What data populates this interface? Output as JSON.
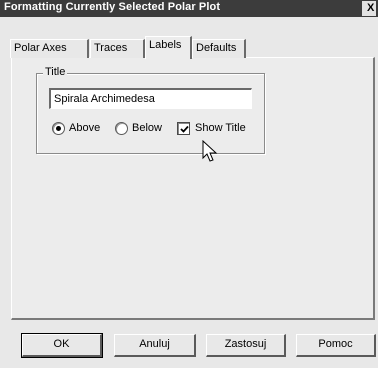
{
  "window": {
    "title": "Formatting Currently Selected Polar Plot",
    "close_label": "X"
  },
  "tabs": [
    {
      "label": "Polar Axes",
      "active": false
    },
    {
      "label": "Traces",
      "active": false
    },
    {
      "label": "Labels",
      "active": true
    },
    {
      "label": "Defaults",
      "active": false
    }
  ],
  "title_group": {
    "legend": "Title",
    "value": "Spirala Archimedesa",
    "position_options": [
      {
        "label": "Above",
        "selected": true
      },
      {
        "label": "Below",
        "selected": false
      }
    ],
    "show_title": {
      "label": "Show Title",
      "checked": true
    }
  },
  "buttons": {
    "ok": "OK",
    "cancel": "Anuluj",
    "apply": "Zastosuj",
    "help": "Pomoc"
  },
  "icons": {
    "cursor": "mouse-pointer-icon",
    "check": "checkmark-icon",
    "radio_dot": "radio-dot-icon"
  }
}
